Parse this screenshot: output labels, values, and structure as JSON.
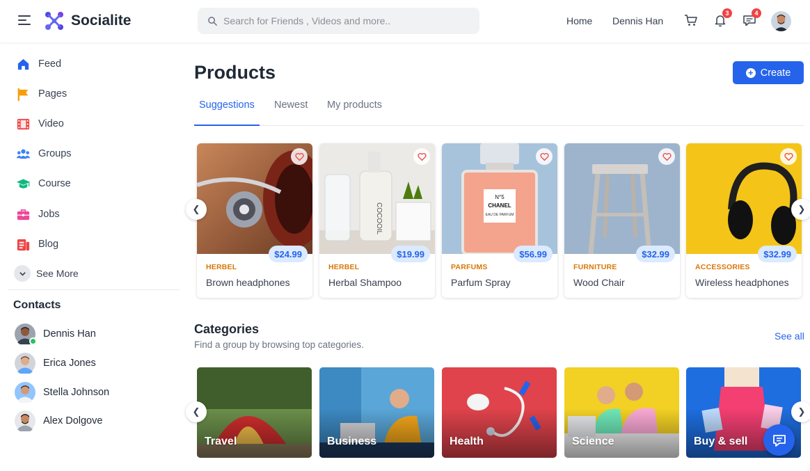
{
  "app": {
    "name": "Socialite"
  },
  "search": {
    "placeholder": "Search for Friends , Videos and more.."
  },
  "header": {
    "nav": [
      "Home",
      "Dennis Han"
    ],
    "notifications_count": "3",
    "messages_count": "4"
  },
  "sidebar": {
    "items": [
      {
        "label": "Feed",
        "icon": "home-icon",
        "color": "#2563eb"
      },
      {
        "label": "Pages",
        "icon": "flag-icon",
        "color": "#f59e0b"
      },
      {
        "label": "Video",
        "icon": "film-icon",
        "color": "#ef4444"
      },
      {
        "label": "Groups",
        "icon": "users-icon",
        "color": "#3b82f6"
      },
      {
        "label": "Course",
        "icon": "graduation-cap-icon",
        "color": "#10b981"
      },
      {
        "label": "Jobs",
        "icon": "briefcase-icon",
        "color": "#ec4899"
      },
      {
        "label": "Blog",
        "icon": "blog-icon",
        "color": "#ef4444"
      }
    ],
    "see_more": "See More",
    "contacts_title": "Contacts",
    "contacts": [
      {
        "name": "Dennis Han",
        "online": true
      },
      {
        "name": "Erica Jones",
        "online": false
      },
      {
        "name": "Stella Johnson",
        "online": false
      },
      {
        "name": "Alex Dolgove",
        "online": false
      }
    ]
  },
  "main": {
    "title": "Products",
    "create_label": "Create",
    "tabs": [
      "Suggestions",
      "Newest",
      "My products"
    ],
    "active_tab": "Suggestions",
    "products": [
      {
        "category": "HERBEL",
        "name": "Brown headphones",
        "price": "$24.99"
      },
      {
        "category": "HERBEL",
        "name": "Herbal Shampoo",
        "price": "$19.99"
      },
      {
        "category": "PARFUMS",
        "name": "Parfum Spray",
        "price": "$56.99"
      },
      {
        "category": "FURNITURE",
        "name": "Wood Chair",
        "price": "$32.99"
      },
      {
        "category": "ACCESSORIES",
        "name": "Wireless headphones",
        "price": "$32.99"
      }
    ],
    "categories_title": "Categories",
    "categories_subtitle": "Find a group by browsing top categories.",
    "see_all": "See all",
    "categories": [
      "Travel",
      "Business",
      "Health",
      "Science",
      "Buy & sell"
    ],
    "perfume_label": [
      "N°5",
      "CHANEL",
      "EAU DE PARFUM"
    ],
    "shampoo_label": "COCOOIL"
  },
  "colors": {
    "accent": "#2563eb",
    "category_text": "#d97706",
    "price_bg": "#dbeafe"
  }
}
